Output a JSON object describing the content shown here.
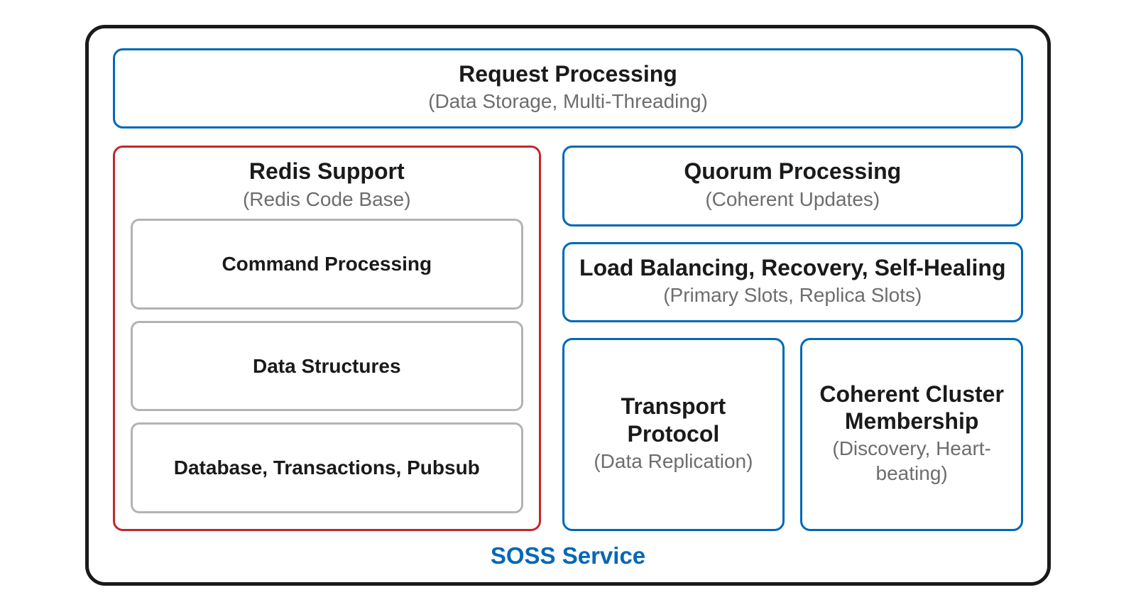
{
  "service_label": "SOSS Service",
  "request_processing": {
    "title": "Request Processing",
    "subtitle": "(Data Storage, Multi-Threading)"
  },
  "redis_support": {
    "title": "Redis Support",
    "subtitle": "(Redis Code Base)",
    "items": [
      {
        "title": "Command Processing"
      },
      {
        "title": "Data Structures"
      },
      {
        "title": "Database, Transactions, Pubsub"
      }
    ]
  },
  "quorum": {
    "title": "Quorum Processing",
    "subtitle": "(Coherent Updates)"
  },
  "load_balancing": {
    "title": "Load Balancing, Recovery, Self-Healing",
    "subtitle": "(Primary Slots, Replica Slots)"
  },
  "transport": {
    "title": "Transport Protocol",
    "subtitle": "(Data Replication)"
  },
  "membership": {
    "title": "Coherent Cluster Membership",
    "subtitle": "(Discovery, Heart-beating)"
  }
}
